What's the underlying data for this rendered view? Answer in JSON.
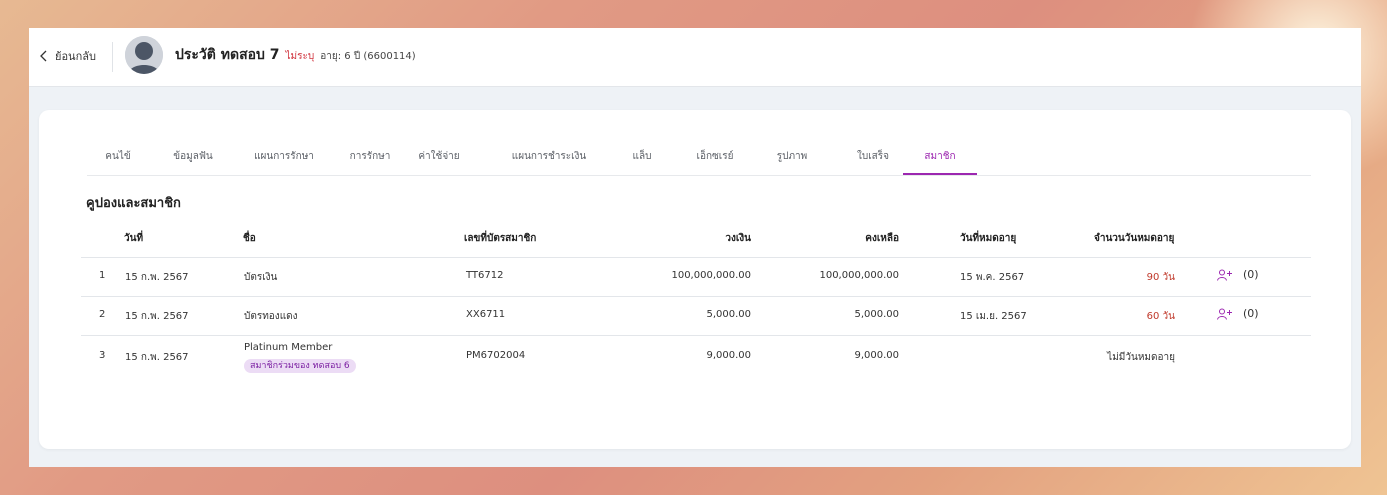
{
  "header": {
    "back_label": "ย้อนกลับ",
    "patient_title": "ประวัติ ทดสอบ 7",
    "gender": "ไม่ระบุ",
    "age_info": "อายุ: 6 ปี  (6600114)"
  },
  "tabs": [
    {
      "label": "คนไข้"
    },
    {
      "label": "ข้อมูลฟัน"
    },
    {
      "label": "แผนการรักษา"
    },
    {
      "label": "การรักษา"
    },
    {
      "label": "ค่าใช้จ่าย"
    },
    {
      "label": "แผนการชำระเงิน"
    },
    {
      "label": "แล็บ"
    },
    {
      "label": "เอ็กซเรย์"
    },
    {
      "label": "รูปภาพ"
    },
    {
      "label": "ใบเสร็จ"
    },
    {
      "label": "สมาชิก"
    }
  ],
  "active_tab": "สมาชิก",
  "accent_color": "#9c27b0",
  "section_title": "คูปองและสมาชิก",
  "table": {
    "headers": {
      "date": "วันที่",
      "name": "ชื่อ",
      "card_no": "เลขที่บัตรสมาชิก",
      "limit": "วงเงิน",
      "balance": "คงเหลือ",
      "expiry": "วันที่หมดอายุ",
      "days_left": "จำนวนวันหมดอายุ"
    },
    "rows": [
      {
        "no": "1",
        "date": "15 ก.พ. 2567",
        "name": "บัตรเงิน",
        "card_no": "TT6712",
        "limit": "100,000,000.00",
        "balance": "100,000,000.00",
        "expiry": "15 พ.ค. 2567",
        "days_left": "90 วัน",
        "invite_count": "(0)"
      },
      {
        "no": "2",
        "date": "15 ก.พ. 2567",
        "name": "บัตรทองแดง",
        "card_no": "XX6711",
        "limit": "5,000.00",
        "balance": "5,000.00",
        "expiry": "15 เม.ย. 2567",
        "days_left": "60 วัน",
        "invite_count": "(0)"
      },
      {
        "no": "3",
        "date": "15 ก.พ. 2567",
        "name": "Platinum Member",
        "badge": "สมาชิกร่วมของ ทดสอบ 6",
        "card_no": "PM6702004",
        "limit": "9,000.00",
        "balance": "9,000.00",
        "expiry": "",
        "days_left": "ไม่มีวันหมดอายุ"
      }
    ]
  }
}
